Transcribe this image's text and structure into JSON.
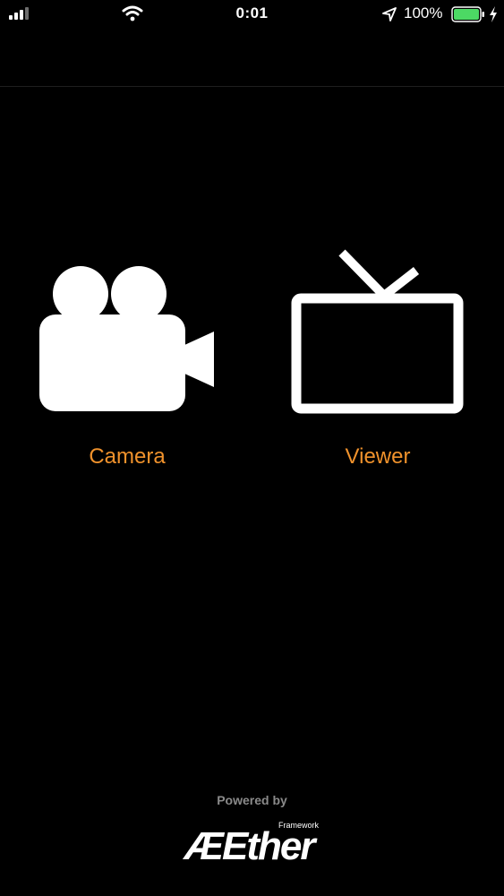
{
  "status_bar": {
    "time": "0:01",
    "battery_percent": "100%",
    "icons": [
      "signal-icon",
      "wifi-icon",
      "location-arrow-icon",
      "battery-icon",
      "charging-bolt-icon"
    ],
    "battery_level": 1.0,
    "battery_color": "#4cd964"
  },
  "launcher": {
    "items": [
      {
        "label": "Camera",
        "icon": "video-camera-icon"
      },
      {
        "label": "Viewer",
        "icon": "television-icon"
      }
    ],
    "label_color": "#f0922c"
  },
  "footer": {
    "powered_by": "Powered by",
    "logo_text": "ÆEther",
    "logo_subtext": "Framework"
  }
}
